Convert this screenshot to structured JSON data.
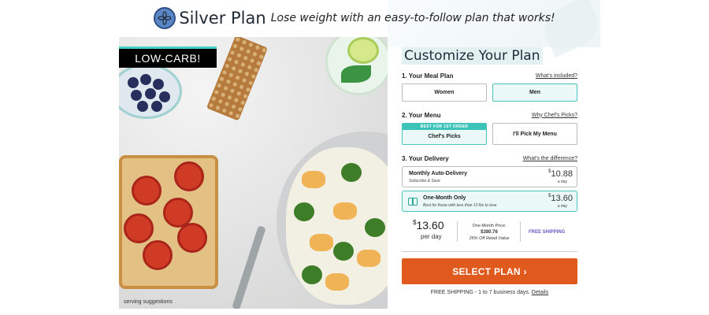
{
  "header": {
    "brand": "Silver Plan",
    "tagline": "Lose weight with an easy-to-follow plan that works!"
  },
  "hero": {
    "badge": "LOW-CARB!",
    "caption": "serving suggestions"
  },
  "panel": {
    "title": "Customize Your Plan",
    "step1": {
      "label": "1. Your Meal Plan",
      "link": "What's included?",
      "options": [
        "Women",
        "Men"
      ],
      "selected": "Men"
    },
    "step2": {
      "label": "2. Your Menu",
      "link": "Why Chef's Picks?",
      "best_tag": "BEST FOR 1ST ORDER",
      "options": [
        "Chef's Picks",
        "I'll Pick My Menu"
      ],
      "selected": "Chef's Picks"
    },
    "step3": {
      "label": "3. Your Delivery",
      "link": "What's the difference?",
      "options": [
        {
          "title": "Monthly Auto-Delivery",
          "subtitle": "Subscribe & Save",
          "currency": "$",
          "price": "10.88",
          "unit": "a day"
        },
        {
          "title": "One-Month Only",
          "subtitle": "Best for those with less than 10 lbs to lose",
          "currency": "$",
          "price": "13.60",
          "unit": "a day"
        }
      ],
      "selected": "One-Month Only"
    },
    "summary": {
      "currency": "$",
      "price": "13.60",
      "per": "per day",
      "one_month_label": "One-Month Price:",
      "one_month_price": "$380.76",
      "retail_note": "25% Off Retail Value",
      "free_shipping": "FREE SHIPPING"
    },
    "cta": "SELECT PLAN ›",
    "shipping_note": "FREE SHIPPING - 1 to 7 business days.",
    "shipping_link": "Details"
  },
  "colors": {
    "accent": "#45d0c8",
    "cta": "#e15a1d",
    "free_shipping": "#6a5ac2"
  }
}
